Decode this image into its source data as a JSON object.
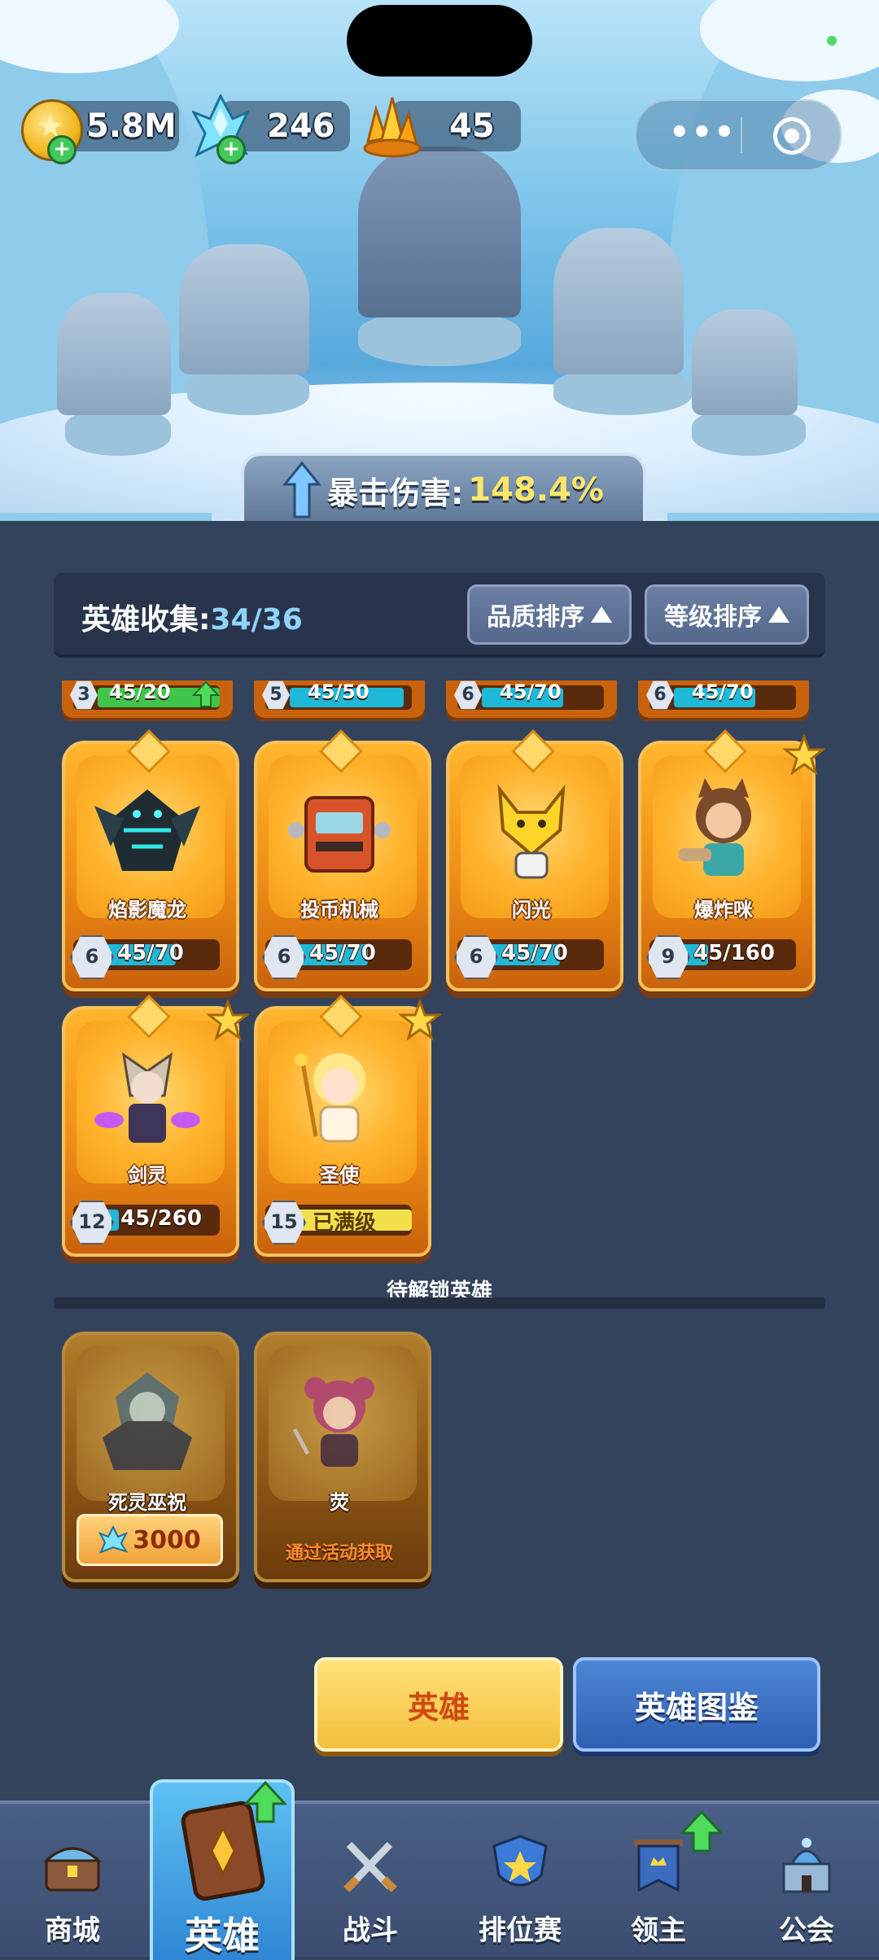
{
  "resources": {
    "gold": "5.8M",
    "crystals": "246",
    "amber": "45"
  },
  "crit": {
    "label": "暴击伤害:",
    "value": "148.4%"
  },
  "collection": {
    "label": "英雄收集:",
    "count": "34/36"
  },
  "sort": {
    "quality": "品质排序",
    "level": "等级排序"
  },
  "partial_row": [
    {
      "level": "3",
      "progress": "45/20",
      "fill": 1.0,
      "upgradable": true
    },
    {
      "level": "5",
      "progress": "45/50",
      "fill": 0.9,
      "upgradable": false
    },
    {
      "level": "6",
      "progress": "45/70",
      "fill": 0.64,
      "upgradable": false
    },
    {
      "level": "6",
      "progress": "45/70",
      "fill": 0.64,
      "upgradable": false
    }
  ],
  "heroes": [
    {
      "name": "焰影魔龙",
      "level": "6",
      "progress": "45/70",
      "fill": 0.64,
      "star": false,
      "icon": "shadow-dragon"
    },
    {
      "name": "投币机械",
      "level": "6",
      "progress": "45/70",
      "fill": 0.64,
      "star": false,
      "icon": "coin-robot"
    },
    {
      "name": "闪光",
      "level": "6",
      "progress": "45/70",
      "fill": 0.64,
      "star": false,
      "icon": "flash-fox"
    },
    {
      "name": "爆炸咪",
      "level": "9",
      "progress": "45/160",
      "fill": 0.28,
      "star": true,
      "icon": "cat-girl"
    },
    {
      "name": "剑灵",
      "level": "12",
      "progress": "45/260",
      "fill": 0.17,
      "star": true,
      "icon": "sword-spirit"
    },
    {
      "name": "圣使",
      "level": "15",
      "progress": "已满级",
      "fill": 1.0,
      "star": true,
      "max": true,
      "icon": "angel"
    }
  ],
  "locked": {
    "title": "待解锁英雄",
    "heroes": [
      {
        "name": "死灵巫祝",
        "price": "3000",
        "icon": "necromancer"
      },
      {
        "name": "荧",
        "note": "通过活动获取",
        "icon": "witch-girl"
      }
    ]
  },
  "buttons": {
    "heroes": "英雄",
    "codex": "英雄图鉴"
  },
  "nav": [
    {
      "label": "商城",
      "icon": "chest-icon"
    },
    {
      "label": "英雄",
      "icon": "hero-card-icon",
      "active": true
    },
    {
      "label": "战斗",
      "icon": "swords-icon"
    },
    {
      "label": "排位赛",
      "icon": "rank-shield-icon"
    },
    {
      "label": "领主",
      "icon": "banner-icon"
    },
    {
      "label": "公会",
      "icon": "castle-icon"
    }
  ],
  "colors": {
    "accent": "#ffe66a",
    "panel": "#34435c",
    "card": "#f08d16",
    "progress": "#1fb8d8"
  }
}
